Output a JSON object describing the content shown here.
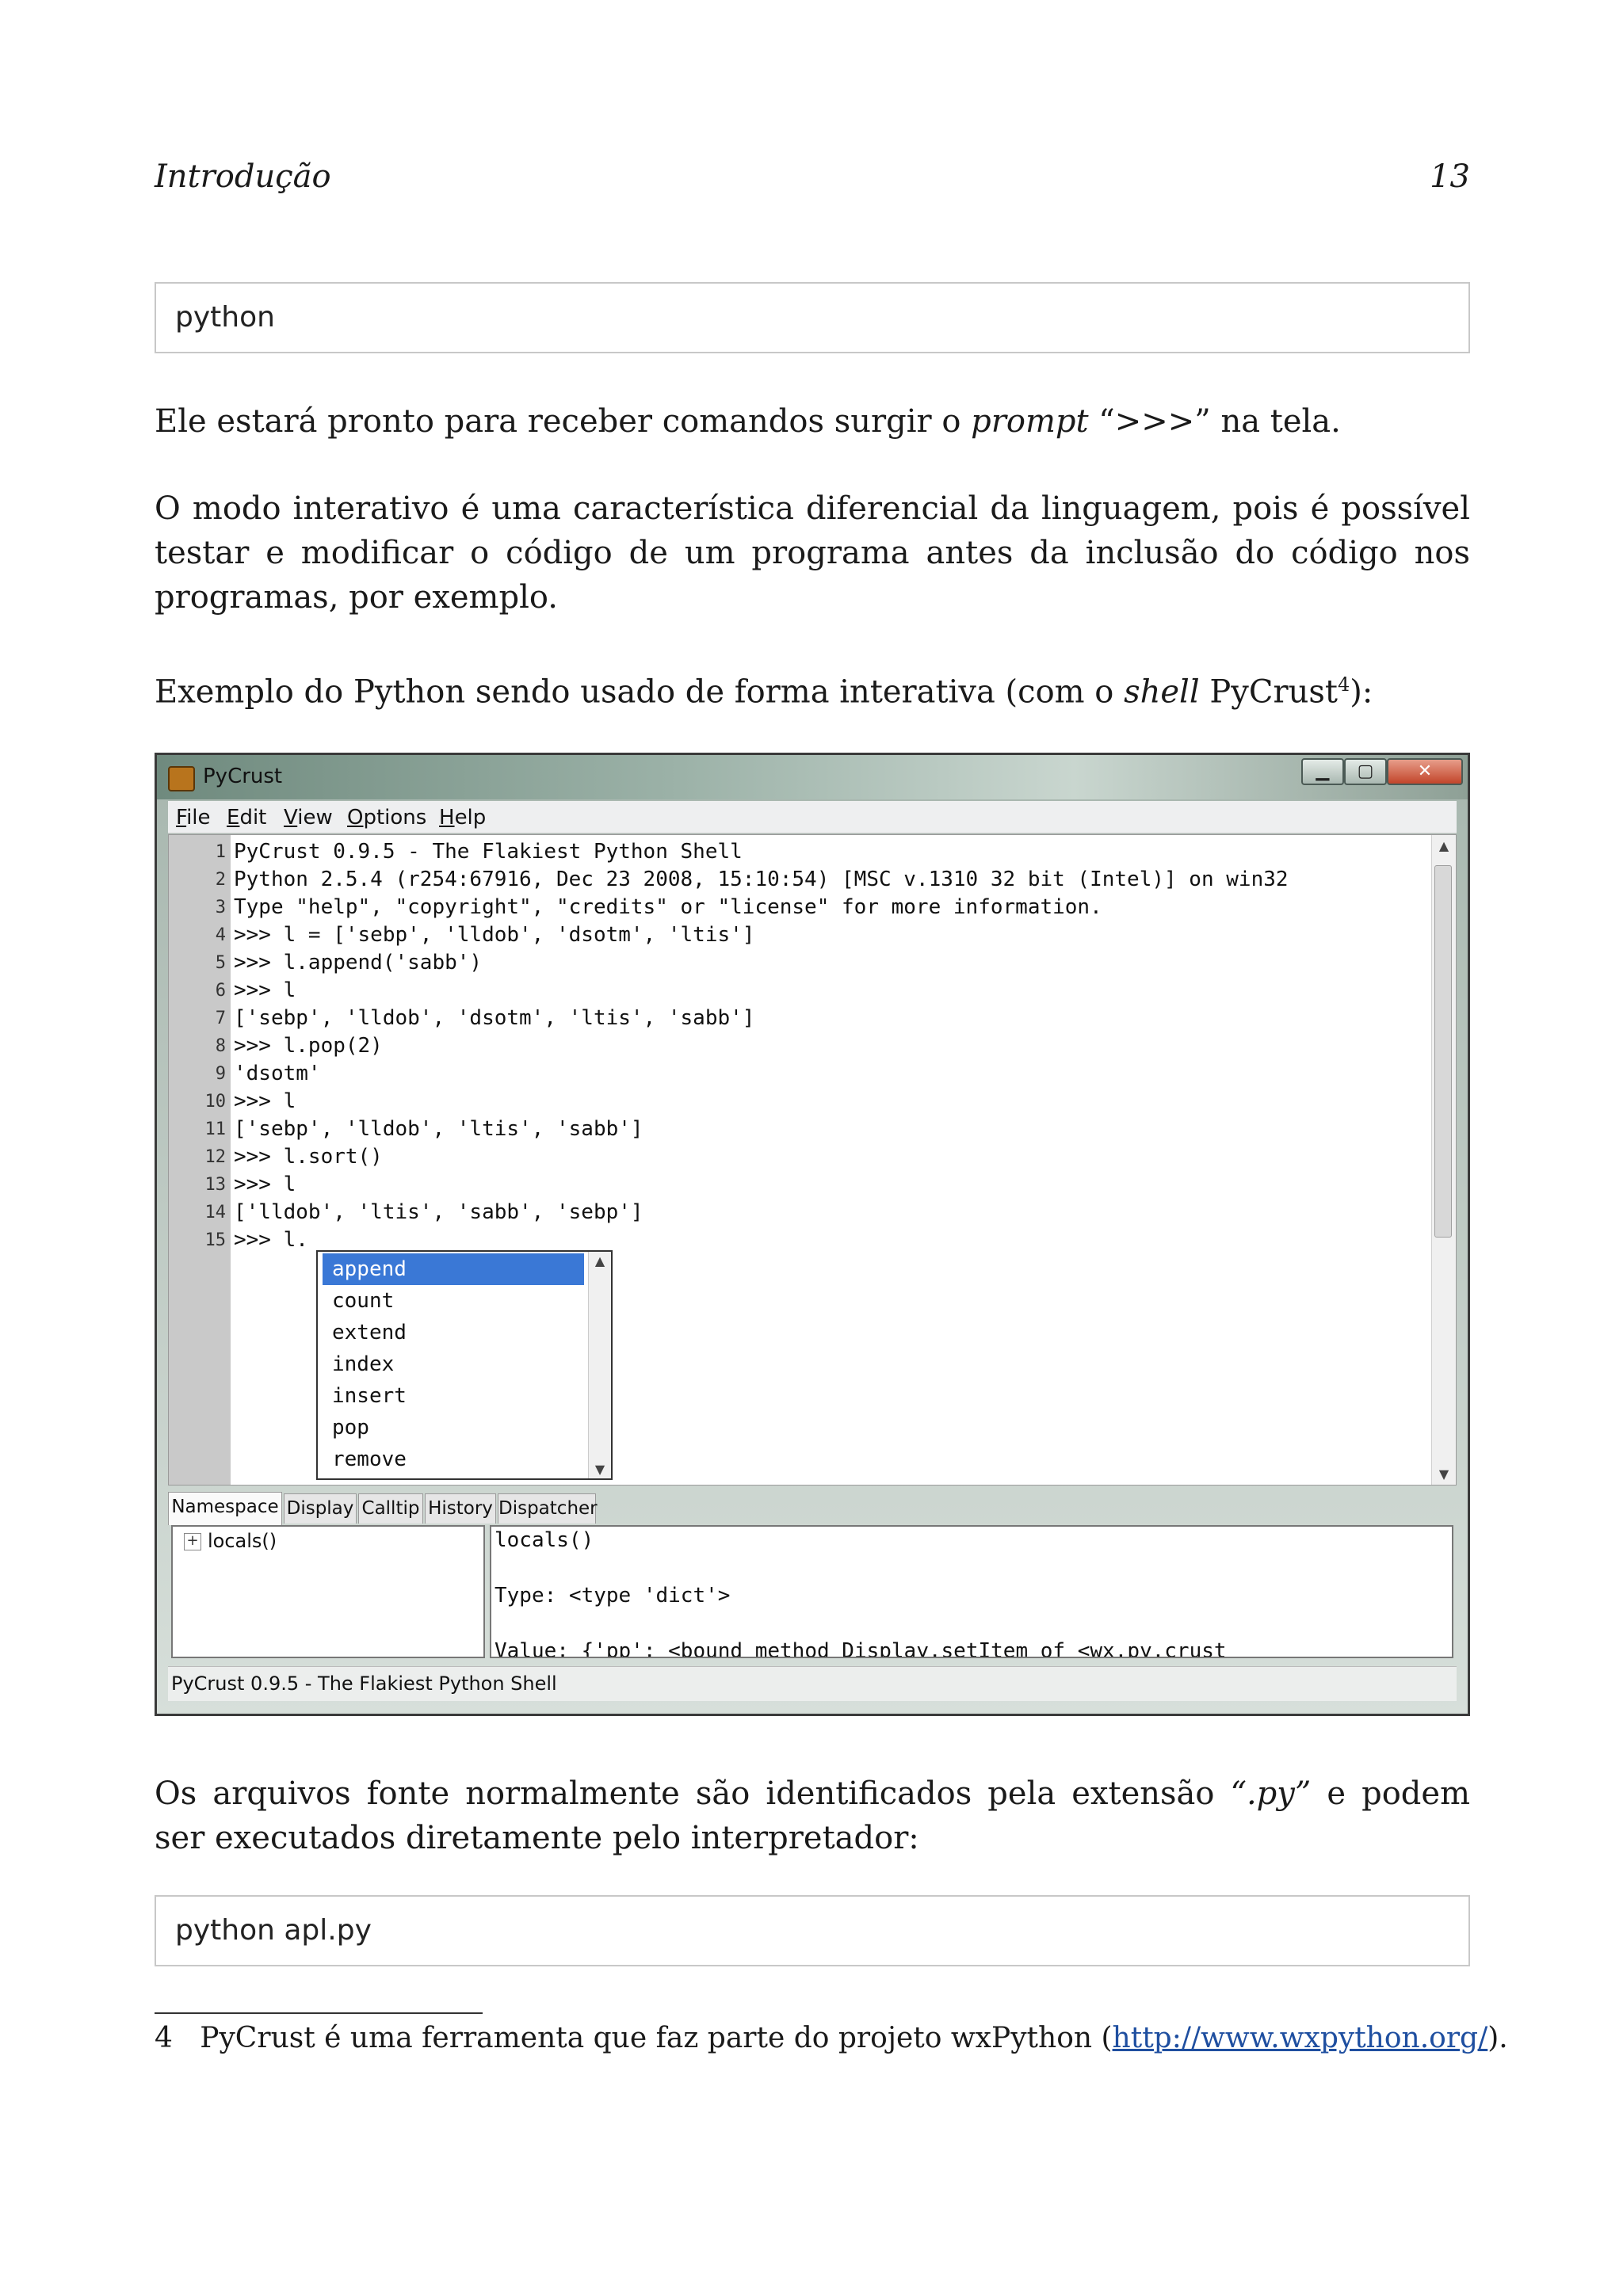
{
  "header": {
    "title": "Introdução",
    "page_number": "13"
  },
  "code_boxes": [
    "python",
    "python apl.py"
  ],
  "paragraphs": {
    "p1_before": "Ele estará pronto para receber comandos surgir o ",
    "p1_em": "prompt",
    "p1_after": " “>>>” na tela.",
    "p2": "O modo interativo é uma característica diferencial da linguagem, pois é possível testar e modificar o código de um programa antes da inclusão do código nos programas, por exemplo.",
    "p3_before": "Exemplo do Python sendo usado de forma interativa (com o ",
    "p3_em": "shell",
    "p3_mid": " PyCrust",
    "p3_sup": "4",
    "p3_after": "):",
    "p4_before": "Os arquivos fonte normalmente são identificados pela extensão ",
    "p4_em": "“.py”",
    "p4_after": " e podem ser executados diretamente pelo interpretador:"
  },
  "window": {
    "title": "PyCrust",
    "buttons": {
      "min": "▁",
      "max": "▢",
      "close": "✕"
    },
    "menu": [
      "File",
      "Edit",
      "View",
      "Options",
      "Help"
    ],
    "lines": [
      {
        "n": "1",
        "text": "PyCrust 0.9.5 - The Flakiest Python Shell"
      },
      {
        "n": "2",
        "text": "Python 2.5.4 (r254:67916, Dec 23 2008, 15:10:54) [MSC v.1310 32 bit (Intel)] on win32"
      },
      {
        "n": "3",
        "text": "Type \"help\", \"copyright\", \"credits\" or \"license\" for more information."
      },
      {
        "n": "4",
        "text": ">>> l = ['sebp', 'lldob', 'dsotm', 'ltis']"
      },
      {
        "n": "5",
        "text": ">>> l.append('sabb')"
      },
      {
        "n": "6",
        "text": ">>> l"
      },
      {
        "n": "7",
        "text": "['sebp', 'lldob', 'dsotm', 'ltis', 'sabb']"
      },
      {
        "n": "8",
        "text": ">>> l.pop(2)"
      },
      {
        "n": "9",
        "text": "'dsotm'"
      },
      {
        "n": "10",
        "text": ">>> l"
      },
      {
        "n": "11",
        "text": "['sebp', 'lldob', 'ltis', 'sabb']"
      },
      {
        "n": "12",
        "text": ">>> l.sort()"
      },
      {
        "n": "13",
        "text": ">>> l"
      },
      {
        "n": "14",
        "text": "['lldob', 'ltis', 'sabb', 'sebp']"
      },
      {
        "n": "15",
        "text": ">>> l."
      }
    ],
    "autocomplete": [
      "append",
      "count",
      "extend",
      "index",
      "insert",
      "pop",
      "remove"
    ],
    "autocomplete_selected": "append",
    "tabs": [
      "Namespace",
      "Display",
      "Calltip",
      "History",
      "Dispatcher"
    ],
    "active_tab": "Namespace",
    "tree_item": "locals()",
    "detail_lines": [
      "locals()",
      "",
      "Type: <type 'dict'>",
      "",
      "Value: {'pp': <bound method Display.setItem of <wx.py.crust"
    ],
    "status": "PyCrust 0.9.5 - The Flakiest Python Shell"
  },
  "footnote": {
    "number": "4",
    "text_before": "PyCrust é uma ferramenta que faz parte do projeto wxPython (",
    "link": "http://www.wxpython.org/",
    "text_after": ")."
  }
}
